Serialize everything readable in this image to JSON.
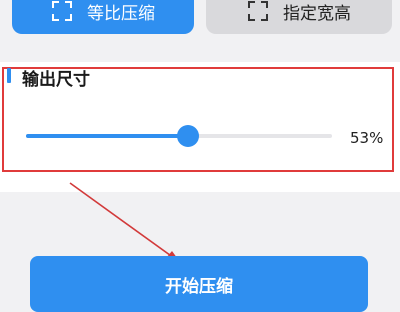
{
  "top_buttons": {
    "ratio_label": "等比压缩",
    "size_label": "指定宽高"
  },
  "output_size": {
    "title": "输出尺寸",
    "slider_value": 0.53,
    "value_text": "53%"
  },
  "action": {
    "start_label": "开始压缩"
  },
  "colors": {
    "accent": "#2f8ff0",
    "highlight": "#e03b3b",
    "secondary_button": "#d9d9dc"
  }
}
